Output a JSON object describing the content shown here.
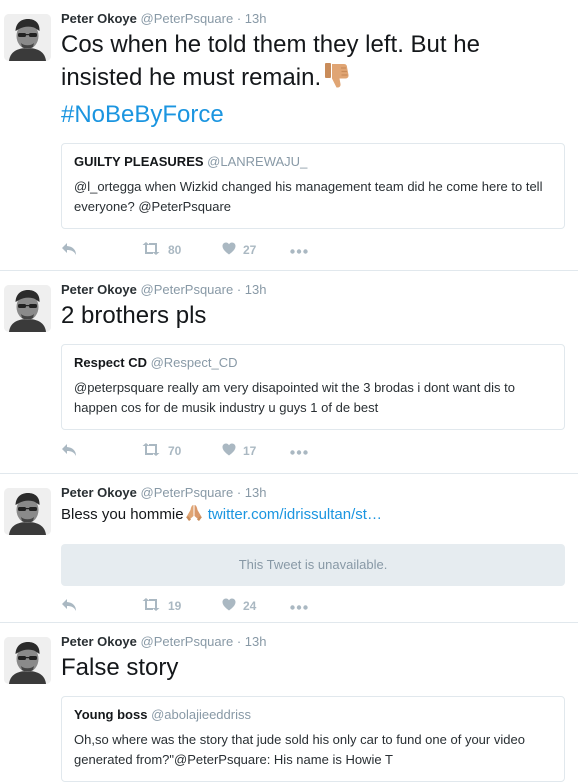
{
  "colors": {
    "link": "#1b95e0",
    "muted": "#8899a6",
    "action_gray": "#aab8c2",
    "unavailable_bg": "#e6ecf0"
  },
  "tweets": [
    {
      "author": "Peter Okoye",
      "handle": "@PeterPsquare",
      "sep": "·",
      "time": "13h",
      "text": "Cos when he told them they left. But he insisted he must remain.",
      "emoji": "thumbs-down",
      "hashtag": "#NoBeByForce",
      "quote": {
        "name": "GUILTY PLEASURES",
        "handle": "@LANREWAJU_",
        "text": "@l_ortegga when Wizkid changed his management team did he come here to tell everyone? @PeterPsquare"
      },
      "retweets": "80",
      "likes": "27"
    },
    {
      "author": "Peter Okoye",
      "handle": "@PeterPsquare",
      "sep": "·",
      "time": "13h",
      "text": "2 brothers pls",
      "quote": {
        "name": "Respect CD",
        "handle": "@Respect_CD",
        "text": "@peterpsquare really am very disapointed wit the 3 brodas i dont want dis to happen cos for de musik industry u guys 1 of de best"
      },
      "retweets": "70",
      "likes": "17"
    },
    {
      "author": "Peter Okoye",
      "handle": "@PeterPsquare",
      "sep": "·",
      "time": "13h",
      "text": "Bless you hommie",
      "emoji": "folded-hands",
      "link": "twitter.com/idrissultan/st…",
      "unavailable": "This Tweet is unavailable.",
      "retweets": "19",
      "likes": "24"
    },
    {
      "author": "Peter Okoye",
      "handle": "@PeterPsquare",
      "sep": "·",
      "time": "13h",
      "text": "False story",
      "quote": {
        "name": "Young boss",
        "handle": "@abolajieeddriss",
        "text": "Oh,so where was the story that jude sold his only car to fund one of your video generated from?\"@PeterPsquare: His name is Howie T"
      }
    }
  ],
  "icons": {
    "reply": "reply-icon",
    "retweet": "retweet-icon",
    "like": "heart-icon",
    "more": "more-dots-icon"
  }
}
